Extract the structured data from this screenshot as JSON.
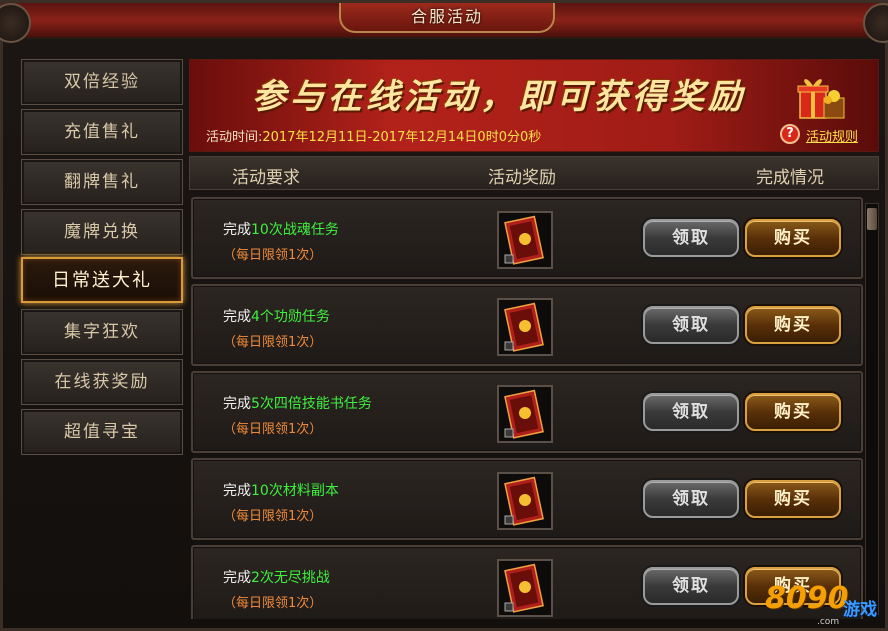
{
  "window": {
    "title": "合服活动"
  },
  "sidebar": {
    "items": [
      {
        "label": "双倍经验",
        "active": false
      },
      {
        "label": "充值售礼",
        "active": false
      },
      {
        "label": "翻牌售礼",
        "active": false
      },
      {
        "label": "魔牌兑换",
        "active": false
      },
      {
        "label": "日常送大礼",
        "active": true
      },
      {
        "label": "集字狂欢",
        "active": false
      },
      {
        "label": "在线获奖励",
        "active": false
      },
      {
        "label": "超值寻宝",
        "active": false
      }
    ]
  },
  "banner": {
    "headline": "参与在线活动，即可获得奖励",
    "time_label": "活动时间:",
    "time_value": "2017年12月11日-2017年12月14日0时0分0秒",
    "rules_link": "活动规则",
    "help_icon": "?"
  },
  "columns": {
    "requirement": "活动要求",
    "reward": "活动奖励",
    "status": "完成情况"
  },
  "tasks": [
    {
      "prefix": "完成",
      "highlight": "10次战魂任务",
      "limit": "（每日限领1次）",
      "claim_label": "领取",
      "buy_label": "购买"
    },
    {
      "prefix": "完成",
      "highlight": "4个功勋任务",
      "limit": "（每日限领1次）",
      "claim_label": "领取",
      "buy_label": "购买"
    },
    {
      "prefix": "完成",
      "highlight": "5次四倍技能书任务",
      "limit": "（每日限领1次）",
      "claim_label": "领取",
      "buy_label": "购买"
    },
    {
      "prefix": "完成",
      "highlight": "10次材料副本",
      "limit": "（每日限领1次）",
      "claim_label": "领取",
      "buy_label": "购买"
    },
    {
      "prefix": "完成",
      "highlight": "2次无尽挑战",
      "limit": "（每日限领1次）",
      "claim_label": "领取",
      "buy_label": "购买"
    }
  ],
  "watermark": {
    "number": "8090",
    "text": "游戏",
    "url": ".com"
  },
  "colors": {
    "accent_gold": "#ffe14a",
    "task_highlight": "#3ef03e",
    "limit_text": "#f08a3a",
    "banner_red": "#b3221a"
  }
}
